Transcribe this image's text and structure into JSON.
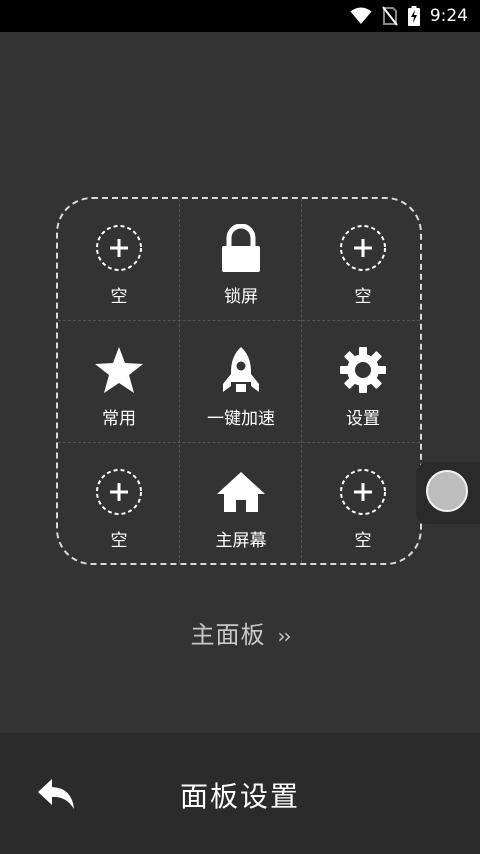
{
  "status_bar": {
    "time": "9:24",
    "icons": [
      "wifi-icon",
      "no-sim-icon",
      "battery-charging-icon"
    ]
  },
  "panel": {
    "cells": [
      {
        "label": "空",
        "icon": "add-circle-icon"
      },
      {
        "label": "锁屏",
        "icon": "lock-icon"
      },
      {
        "label": "空",
        "icon": "add-circle-icon"
      },
      {
        "label": "常用",
        "icon": "star-icon"
      },
      {
        "label": "一键加速",
        "icon": "rocket-icon"
      },
      {
        "label": "设置",
        "icon": "gear-icon"
      },
      {
        "label": "空",
        "icon": "add-circle-icon"
      },
      {
        "label": "主屏幕",
        "icon": "home-icon"
      },
      {
        "label": "空",
        "icon": "add-circle-icon"
      }
    ]
  },
  "main_panel_link": {
    "label": "主面板",
    "arrows": "››"
  },
  "bottom_bar": {
    "title": "面板设置",
    "back_icon": "back-arrow-icon"
  },
  "colors": {
    "background": "#333333",
    "status_bar": "#000000",
    "bottom_bar": "#2b2b2b",
    "link_text": "#c8c8c8"
  }
}
